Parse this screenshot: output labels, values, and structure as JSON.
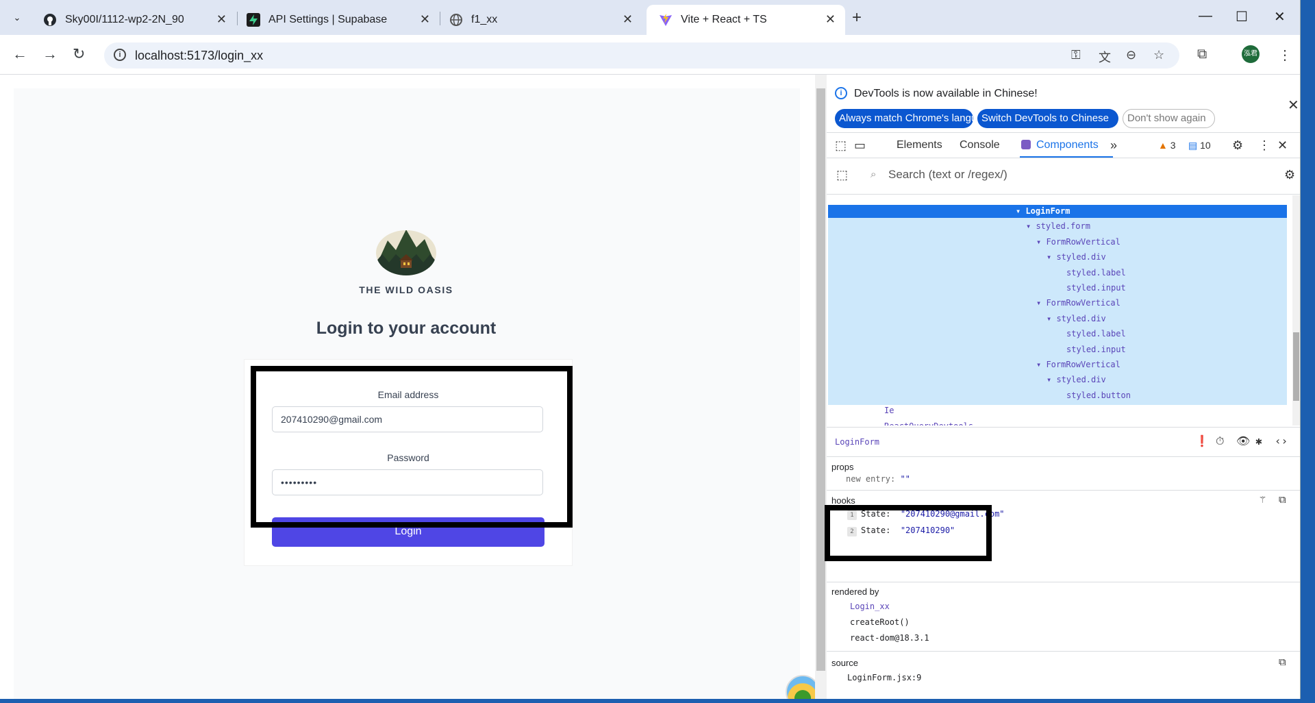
{
  "browser": {
    "tabs": [
      {
        "title": "Sky00I/1112-wp2-2N_90",
        "icon": "github-icon"
      },
      {
        "title": "API Settings | Supabase",
        "icon": "supabase-icon"
      },
      {
        "title": "f1_xx",
        "icon": "globe-icon"
      },
      {
        "title": "Vite + React + TS",
        "icon": "vite-icon",
        "active": true
      }
    ],
    "url": "localhost:5173/login_xx",
    "profile_initials": "泓君"
  },
  "page": {
    "brand": "THE WILD OASIS",
    "heading": "Login to your account",
    "email_label": "Email address",
    "email_value": "207410290@gmail.com",
    "password_label": "Password",
    "password_value": "•••••••••",
    "login_button": "Login"
  },
  "devtools": {
    "banner_text": "DevTools is now available in Chinese!",
    "banner_buttons": [
      "Always match Chrome's language",
      "Switch DevTools to Chinese",
      "Don't show again"
    ],
    "tabs": [
      "Elements",
      "Console",
      "Components"
    ],
    "warnings_count": "3",
    "messages_count": "10",
    "search_placeholder": "Search (text or /regex/)",
    "tree": [
      {
        "label": "LoginForm",
        "depth": 0,
        "arrow": true,
        "selected": true
      },
      {
        "label": "styled.form",
        "depth": 1,
        "arrow": true
      },
      {
        "label": "FormRowVertical",
        "depth": 2,
        "arrow": true
      },
      {
        "label": "styled.div",
        "depth": 3,
        "arrow": true
      },
      {
        "label": "styled.label",
        "depth": 4,
        "arrow": false
      },
      {
        "label": "styled.input",
        "depth": 4,
        "arrow": false
      },
      {
        "label": "FormRowVertical",
        "depth": 2,
        "arrow": true
      },
      {
        "label": "styled.div",
        "depth": 3,
        "arrow": true
      },
      {
        "label": "styled.label",
        "depth": 4,
        "arrow": false
      },
      {
        "label": "styled.input",
        "depth": 4,
        "arrow": false
      },
      {
        "label": "FormRowVertical",
        "depth": 2,
        "arrow": true
      },
      {
        "label": "styled.div",
        "depth": 3,
        "arrow": true
      },
      {
        "label": "styled.button",
        "depth": 4,
        "arrow": false
      },
      {
        "label": "Ie",
        "depth": -5,
        "arrow": false
      },
      {
        "label": "ReactQueryDevtools",
        "depth": -5,
        "arrow": false
      }
    ],
    "selected_component": "LoginForm",
    "props_title": "props",
    "props_new_entry_key": "new entry:",
    "props_new_entry_value": "\"\"",
    "hooks_title": "hooks",
    "hooks": [
      {
        "index": "1",
        "name": "State:",
        "value": "\"207410290@gmail.com\""
      },
      {
        "index": "2",
        "name": "State:",
        "value": "\"207410290\""
      }
    ],
    "rendered_by_title": "rendered by",
    "rendered_by": [
      "Login_xx",
      "createRoot()",
      "react-dom@18.3.1"
    ],
    "source_title": "source",
    "source_file": "LoginForm.jsx:9"
  }
}
